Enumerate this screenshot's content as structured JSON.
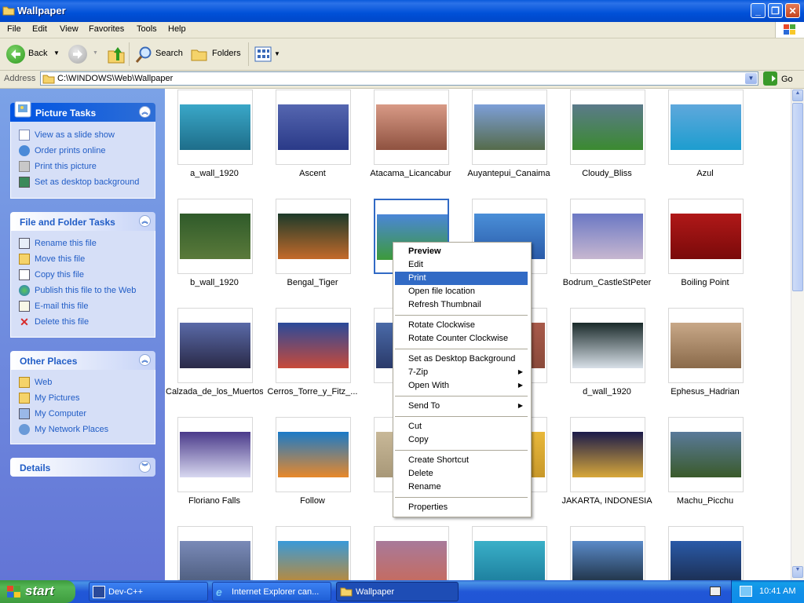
{
  "window": {
    "title": "Wallpaper"
  },
  "menubar": {
    "items": [
      "File",
      "Edit",
      "View",
      "Favorites",
      "Tools",
      "Help"
    ]
  },
  "toolbar": {
    "back_label": "Back",
    "search_label": "Search",
    "folders_label": "Folders"
  },
  "address": {
    "label": "Address",
    "path": "C:\\WINDOWS\\Web\\Wallpaper",
    "go_label": "Go"
  },
  "left_panel": {
    "picture_tasks": {
      "title": "Picture Tasks",
      "items": [
        "View as a slide show",
        "Order prints online",
        "Print this picture",
        "Set as desktop background"
      ]
    },
    "file_tasks": {
      "title": "File and Folder Tasks",
      "items": [
        "Rename this file",
        "Move this file",
        "Copy this file",
        "Publish this file to the Web",
        "E-mail this file",
        "Delete this file"
      ]
    },
    "other_places": {
      "title": "Other Places",
      "items": [
        "Web",
        "My Pictures",
        "My Computer",
        "My Network Places"
      ]
    },
    "details": {
      "title": "Details"
    }
  },
  "thumbnails": [
    {
      "name": "a_wall_1920",
      "colors": [
        "#3aa7c8",
        "#1e6e8a"
      ]
    },
    {
      "name": "Ascent",
      "colors": [
        "#5566b0",
        "#2a3a88"
      ]
    },
    {
      "name": "Atacama_Licancabur",
      "colors": [
        "#d89a86",
        "#8f5240"
      ]
    },
    {
      "name": "Auyantepui_Canaima",
      "colors": [
        "#7d9fd8",
        "#556b4a"
      ]
    },
    {
      "name": "Cloudy_Bliss",
      "colors": [
        "#5b7a8a",
        "#3b8a30"
      ]
    },
    {
      "name": "Azul",
      "colors": [
        "#5fa8dc",
        "#1d9dcf"
      ]
    },
    {
      "name": "b_wall_1920",
      "colors": [
        "#2f5a2a",
        "#5a7a3a"
      ]
    },
    {
      "name": "Bengal_Tiger",
      "colors": [
        "#1c3a2a",
        "#c46a2a"
      ]
    },
    {
      "name": "",
      "colors": [
        "#4b86d8",
        "#3d9a3a"
      ]
    },
    {
      "name": "",
      "colors": [
        "#4a8fd8",
        "#2a5aa8"
      ]
    },
    {
      "name": "Bodrum_CastleStPeter",
      "colors": [
        "#6b78c4",
        "#c7b7d0"
      ]
    },
    {
      "name": "Boiling Point",
      "colors": [
        "#b01818",
        "#7a0a0a"
      ]
    },
    {
      "name": "Calzada_de_los_Muertos",
      "colors": [
        "#5a6aa8",
        "#2a2a48"
      ]
    },
    {
      "name": "Cerros_Torre_y_Fitz_...",
      "colors": [
        "#2a4a9a",
        "#c84a3a"
      ]
    },
    {
      "name": "Cerros_",
      "colors": [
        "#4a6aa8",
        "#2a3a6a"
      ]
    },
    {
      "name": "",
      "colors": [
        "#a85a4a",
        "#8a4a3a"
      ]
    },
    {
      "name": "d_wall_1920",
      "colors": [
        "#1a2a2a",
        "#d8e0e8"
      ]
    },
    {
      "name": "Ephesus_Hadrian",
      "colors": [
        "#c8a888",
        "#8a6a4a"
      ]
    },
    {
      "name": "Floriano Falls",
      "colors": [
        "#4a3a8a",
        "#d8d8f0"
      ]
    },
    {
      "name": "Follow",
      "colors": [
        "#1a7ac8",
        "#e8882a"
      ]
    },
    {
      "name": "",
      "colors": [
        "#c8b898",
        "#a89878"
      ]
    },
    {
      "name": "",
      "colors": [
        "#e8b83a",
        "#c8982a"
      ]
    },
    {
      "name": "JAKARTA, INDONESIA",
      "colors": [
        "#1a1a4a",
        "#d8a83a"
      ]
    },
    {
      "name": "Machu_Picchu",
      "colors": [
        "#5a7a9a",
        "#3a5a2a"
      ]
    },
    {
      "name": "",
      "colors": [
        "#7a8ab8",
        "#4a5a7a"
      ]
    },
    {
      "name": "",
      "colors": [
        "#3a9ad8",
        "#c8882a"
      ]
    },
    {
      "name": "",
      "colors": [
        "#a87a9a",
        "#c86a5a"
      ]
    },
    {
      "name": "",
      "colors": [
        "#3ab0c8",
        "#1a7a9a"
      ]
    },
    {
      "name": "",
      "colors": [
        "#5a8ac8",
        "#1a2a3a"
      ]
    },
    {
      "name": "",
      "colors": [
        "#2a5aa8",
        "#1a2a4a"
      ]
    }
  ],
  "context_menu": {
    "groups": [
      [
        "Preview",
        "Edit",
        "Print",
        "Open file location",
        "Refresh Thumbnail"
      ],
      [
        "Rotate Clockwise",
        "Rotate Counter Clockwise"
      ],
      [
        "Set as Desktop Background",
        "7-Zip",
        "Open With"
      ],
      [
        "Send To"
      ],
      [
        "Cut",
        "Copy"
      ],
      [
        "Create Shortcut",
        "Delete",
        "Rename"
      ],
      [
        "Properties"
      ]
    ],
    "highlighted": "Print",
    "bold": "Preview",
    "submenus": [
      "7-Zip",
      "Open With",
      "Send To"
    ]
  },
  "taskbar": {
    "start_label": "start",
    "tasks": [
      {
        "label": "Dev-C++",
        "active": false
      },
      {
        "label": "Internet Explorer can...",
        "active": false
      },
      {
        "label": "Wallpaper",
        "active": true
      }
    ],
    "clock": "10:41 AM"
  },
  "colors": {
    "selection": "#316ac5",
    "panel_title": "#215dc6",
    "titlebar": "#0054e3"
  }
}
